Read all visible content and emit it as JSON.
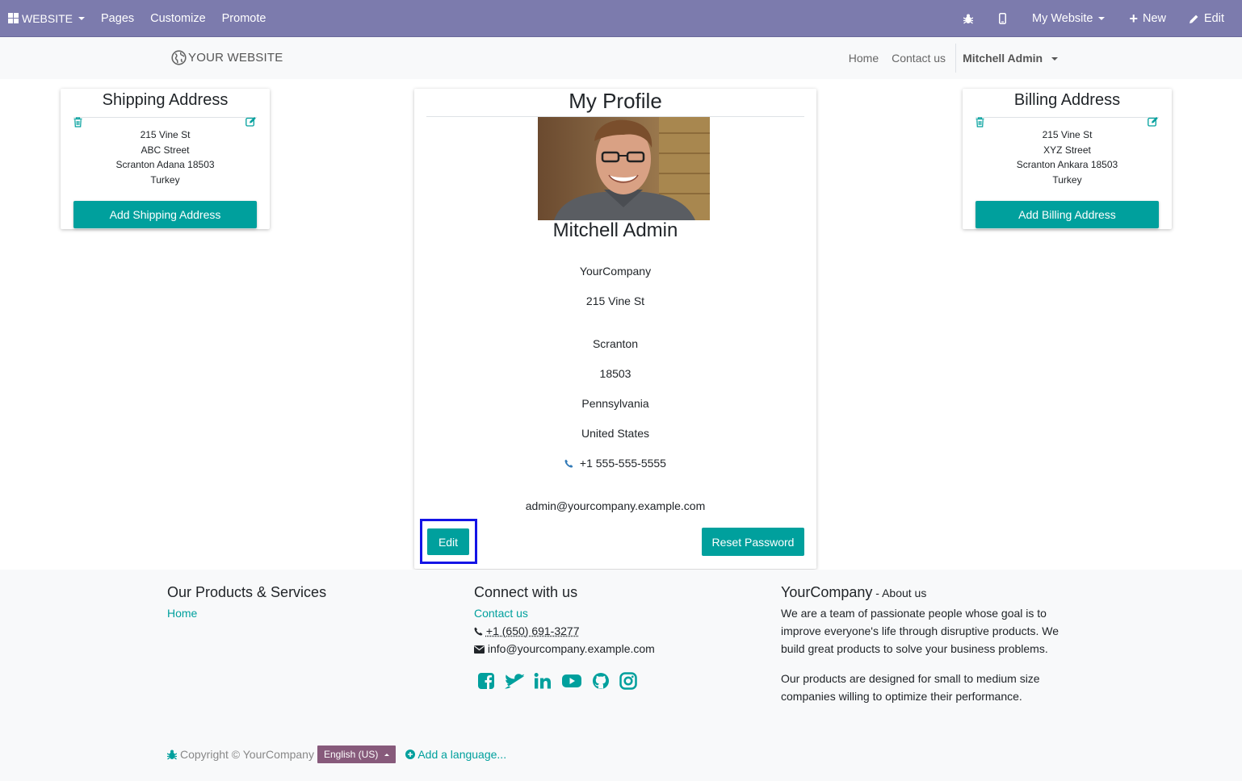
{
  "topbar": {
    "brand": "WEBSITE",
    "menu": [
      "Pages",
      "Customize",
      "Promote"
    ],
    "website_selector": "My Website",
    "new_label": "New",
    "edit_label": "Edit"
  },
  "sitenav": {
    "logo_text": "YOUR WEBSITE",
    "links": [
      "Home",
      "Contact us"
    ],
    "user": "Mitchell Admin"
  },
  "shipping": {
    "title": "Shipping Address",
    "lines": [
      "215 Vine St",
      "ABC Street",
      "Scranton Adana 18503",
      "Turkey"
    ],
    "button": "Add Shipping Address"
  },
  "billing": {
    "title": "Billing Address",
    "lines": [
      "215 Vine St",
      "XYZ Street",
      "Scranton Ankara 18503",
      "Turkey"
    ],
    "button": "Add Billing Address"
  },
  "profile": {
    "title": "My Profile",
    "name": "Mitchell Admin",
    "company": "YourCompany",
    "street": "215 Vine St",
    "city": "Scranton",
    "zip": "18503",
    "state": "Pennsylvania",
    "country": "United States",
    "phone": "+1 555-555-5555",
    "email": "admin@yourcompany.example.com",
    "edit_button": "Edit",
    "reset_button": "Reset Password"
  },
  "footer": {
    "col1": {
      "title": "Our Products & Services",
      "links": [
        "Home"
      ]
    },
    "col2": {
      "title": "Connect with us",
      "contact_link": "Contact us",
      "phone": "+1 (650) 691-3277",
      "email": "info@yourcompany.example.com",
      "social_icons": [
        "facebook-icon",
        "twitter-icon",
        "linkedin-icon",
        "youtube-icon",
        "github-icon",
        "instagram-icon"
      ]
    },
    "col3": {
      "title": "YourCompany",
      "separator": " - ",
      "about_link": "About us",
      "p1": "We are a team of passionate people whose goal is to improve everyone's life through disruptive products. We build great products to solve your business problems.",
      "p2": "Our products are designed for small to medium size companies willing to optimize their performance."
    },
    "copyright": "Copyright © YourCompany",
    "language": "English (US)",
    "add_language": "Add a language..."
  },
  "colors": {
    "topbar": "#7c7bad",
    "accent": "#00a09d",
    "lang_button": "#875a7b",
    "highlight": "#1414e6"
  }
}
